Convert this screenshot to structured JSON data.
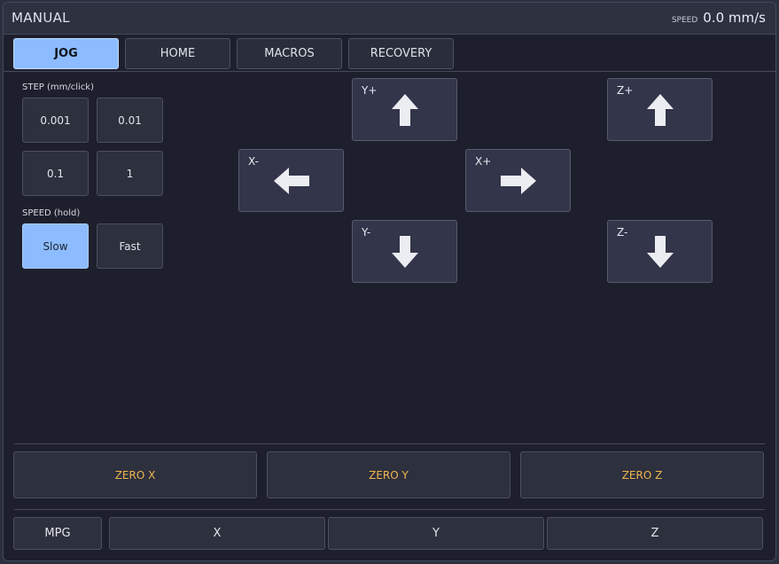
{
  "header": {
    "title": "MANUAL",
    "speed_label": "SPEED",
    "speed_value": "0.0 mm/s"
  },
  "tabs": [
    {
      "label": "JOG",
      "active": true
    },
    {
      "label": "HOME",
      "active": false
    },
    {
      "label": "MACROS",
      "active": false
    },
    {
      "label": "RECOVERY",
      "active": false
    }
  ],
  "step": {
    "label": "STEP (mm/click)",
    "options": [
      "0.001",
      "0.01",
      "0.1",
      "1"
    ]
  },
  "speed": {
    "label": "SPEED (hold)",
    "options": [
      {
        "label": "Slow",
        "selected": true
      },
      {
        "label": "Fast",
        "selected": false
      }
    ]
  },
  "jog": {
    "y_plus": "Y+",
    "y_minus": "Y-",
    "x_minus": "X-",
    "x_plus": "X+",
    "z_plus": "Z+",
    "z_minus": "Z-"
  },
  "zero": [
    "ZERO X",
    "ZERO Y",
    "ZERO Z"
  ],
  "bottom": [
    "MPG",
    "X",
    "Y",
    "Z"
  ],
  "colors": {
    "accent": "#8cbcff",
    "zero_text": "#f0b54e",
    "background": "#1e1f2c"
  }
}
